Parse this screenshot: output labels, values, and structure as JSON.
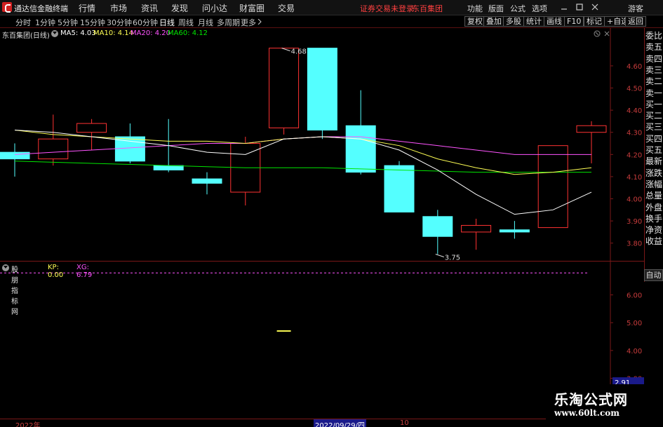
{
  "titlebar": {
    "app_title": "通达信金融终端",
    "menus": [
      "行情",
      "市场",
      "资讯",
      "发现",
      "问小达",
      "财富圈",
      "交易"
    ],
    "notice": "证券交易未登录",
    "notice_stock": "东百集团",
    "right_menus": [
      "功能",
      "版面",
      "公式",
      "选项"
    ],
    "guest": "游客"
  },
  "toolbar": {
    "periods": [
      "分时",
      "1分钟",
      "5分钟",
      "15分钟",
      "30分钟",
      "60分钟",
      "日线",
      "周线",
      "月线",
      "多周期",
      "更多"
    ],
    "active_period": "日线",
    "right_buttons": [
      "复权",
      "叠加",
      "多股",
      "统计",
      "画线",
      "F10",
      "标记",
      "+自选",
      "返回"
    ]
  },
  "main_info": {
    "stock_name": "东百集团(日线)",
    "ma5": "MA5: 4.03",
    "ma10": "MA10: 4.14",
    "ma20": "MA20: 4.20",
    "ma60": "MA60: 4.12"
  },
  "indicator_info": {
    "name": "股朋指标网",
    "kp": "KP: 0.00",
    "xg": "XG: 6.79"
  },
  "right_panel": {
    "items": [
      "委比",
      "卖五",
      "卖四",
      "卖三",
      "卖二",
      "卖一",
      "买一",
      "买二",
      "买三",
      "买四",
      "买五",
      "最新",
      "涨跌",
      "涨幅",
      "总量",
      "外盘",
      "换手",
      "净资",
      "收益"
    ],
    "auto": "自动"
  },
  "bottom": {
    "year": "2022年",
    "date": "2022/09/29/四",
    "day": "10"
  },
  "watermark": {
    "title": "乐淘公式网",
    "url": "www.60lt.com"
  },
  "colors": {
    "up": "#ff3232",
    "down": "#54ffff",
    "ma5": "#ffffff",
    "ma10": "#ffff54",
    "ma20": "#ff54ff",
    "ma60": "#00e600",
    "axis_red": "#7a1818"
  },
  "chart_data": [
    {
      "type": "candlestick",
      "title": "东百集团(日线)",
      "ylim": [
        3.72,
        4.72
      ],
      "yticks": [
        3.8,
        3.9,
        4.0,
        4.1,
        4.2,
        4.3,
        4.4,
        4.5,
        4.6
      ],
      "candles": [
        {
          "o": 4.21,
          "h": 4.25,
          "l": 4.1,
          "c": 4.18
        },
        {
          "o": 4.18,
          "h": 4.38,
          "l": 4.15,
          "c": 4.27
        },
        {
          "o": 4.3,
          "h": 4.36,
          "l": 4.22,
          "c": 4.34
        },
        {
          "o": 4.28,
          "h": 4.34,
          "l": 4.16,
          "c": 4.17
        },
        {
          "o": 4.15,
          "h": 4.36,
          "l": 4.12,
          "c": 4.13
        },
        {
          "o": 4.09,
          "h": 4.12,
          "l": 4.02,
          "c": 4.07
        },
        {
          "o": 4.03,
          "h": 4.28,
          "l": 3.97,
          "c": 4.25
        },
        {
          "o": 4.32,
          "h": 4.68,
          "l": 4.29,
          "c": 4.68
        },
        {
          "o": 4.68,
          "h": 4.68,
          "l": 4.27,
          "c": 4.31
        },
        {
          "o": 4.33,
          "h": 4.49,
          "l": 4.11,
          "c": 4.12
        },
        {
          "o": 4.15,
          "h": 4.17,
          "l": 3.94,
          "c": 3.94
        },
        {
          "o": 3.92,
          "h": 3.95,
          "l": 3.75,
          "c": 3.83
        },
        {
          "o": 3.85,
          "h": 3.91,
          "l": 3.77,
          "c": 3.88
        },
        {
          "o": 3.86,
          "h": 3.9,
          "l": 3.82,
          "c": 3.85
        },
        {
          "o": 3.87,
          "h": 4.24,
          "l": 3.87,
          "c": 4.24
        },
        {
          "o": 4.3,
          "h": 4.35,
          "l": 4.16,
          "c": 4.33
        }
      ],
      "ma5": [
        4.31,
        4.3,
        4.28,
        4.26,
        4.24,
        4.21,
        4.2,
        4.27,
        4.28,
        4.27,
        4.22,
        4.13,
        4.02,
        3.93,
        3.95,
        4.03
      ],
      "ma10": [
        4.31,
        4.29,
        4.28,
        4.27,
        4.26,
        4.26,
        4.25,
        4.27,
        4.28,
        4.27,
        4.24,
        4.18,
        4.14,
        4.11,
        4.12,
        4.14
      ],
      "ma20": [
        4.2,
        4.21,
        4.22,
        4.23,
        4.24,
        4.25,
        4.25,
        4.27,
        4.28,
        4.28,
        4.26,
        4.24,
        4.22,
        4.2,
        4.2,
        4.2
      ],
      "ma60": [
        4.17,
        4.165,
        4.16,
        4.155,
        4.15,
        4.145,
        4.14,
        4.14,
        4.14,
        4.135,
        4.13,
        4.125,
        4.12,
        4.12,
        4.12,
        4.12
      ],
      "annotations": [
        {
          "label": "4.68",
          "index": 7,
          "value": 4.68
        },
        {
          "label": "3.75",
          "index": 11,
          "value": 3.75
        }
      ]
    },
    {
      "type": "line",
      "title": "股朋指标网",
      "ylim": [
        1.55,
        7.2
      ],
      "yticks": [
        2.0,
        3.0,
        4.0,
        5.0,
        6.0
      ],
      "reference_line": 6.79,
      "current_value_label": "2.91",
      "current_value": 2.91,
      "marks": [
        {
          "index": 7,
          "value": 4.7
        }
      ]
    }
  ]
}
